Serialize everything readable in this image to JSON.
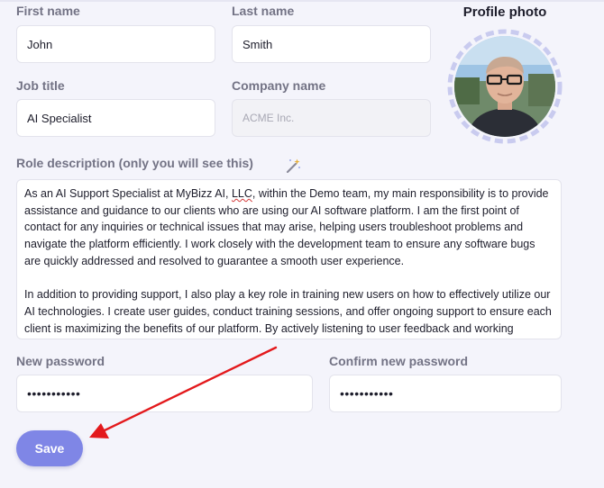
{
  "form": {
    "first_name": {
      "label": "First name",
      "value": "John"
    },
    "last_name": {
      "label": "Last name",
      "value": "Smith"
    },
    "job_title": {
      "label": "Job title",
      "value": "AI Specialist"
    },
    "company_name": {
      "label": "Company name",
      "placeholder": "ACME Inc."
    },
    "role_description": {
      "label": "Role description (only you will see this)",
      "paragraph1_before": "As an AI Support Specialist at MyBizz AI, ",
      "paragraph1_misspelled": "LLC",
      "paragraph1_after": ", within the Demo team, my main responsibility is to provide assistance and guidance to our clients who are using our AI software platform. I am the first point of contact for any inquiries or technical issues that may arise, helping users troubleshoot problems and navigate the platform efficiently. I work closely with the development team to ensure any software bugs are quickly addressed and resolved to guarantee a smooth user experience.",
      "paragraph2": "In addition to providing support, I also play a key role in training new users on how to effectively utilize our AI technologies. I create user guides, conduct training sessions, and offer ongoing support to ensure each client is maximizing the benefits of our platform. By actively listening to user feedback and working"
    },
    "new_password": {
      "label": "New password",
      "value": "•••••••••••"
    },
    "confirm_password": {
      "label": "Confirm new password",
      "value": "•••••••••••"
    },
    "save_label": "Save"
  },
  "profile_photo": {
    "title": "Profile photo"
  },
  "icons": {
    "wand": "magic-wand-icon"
  },
  "colors": {
    "accent": "#7f86e6",
    "arrow": "#e3191c"
  }
}
